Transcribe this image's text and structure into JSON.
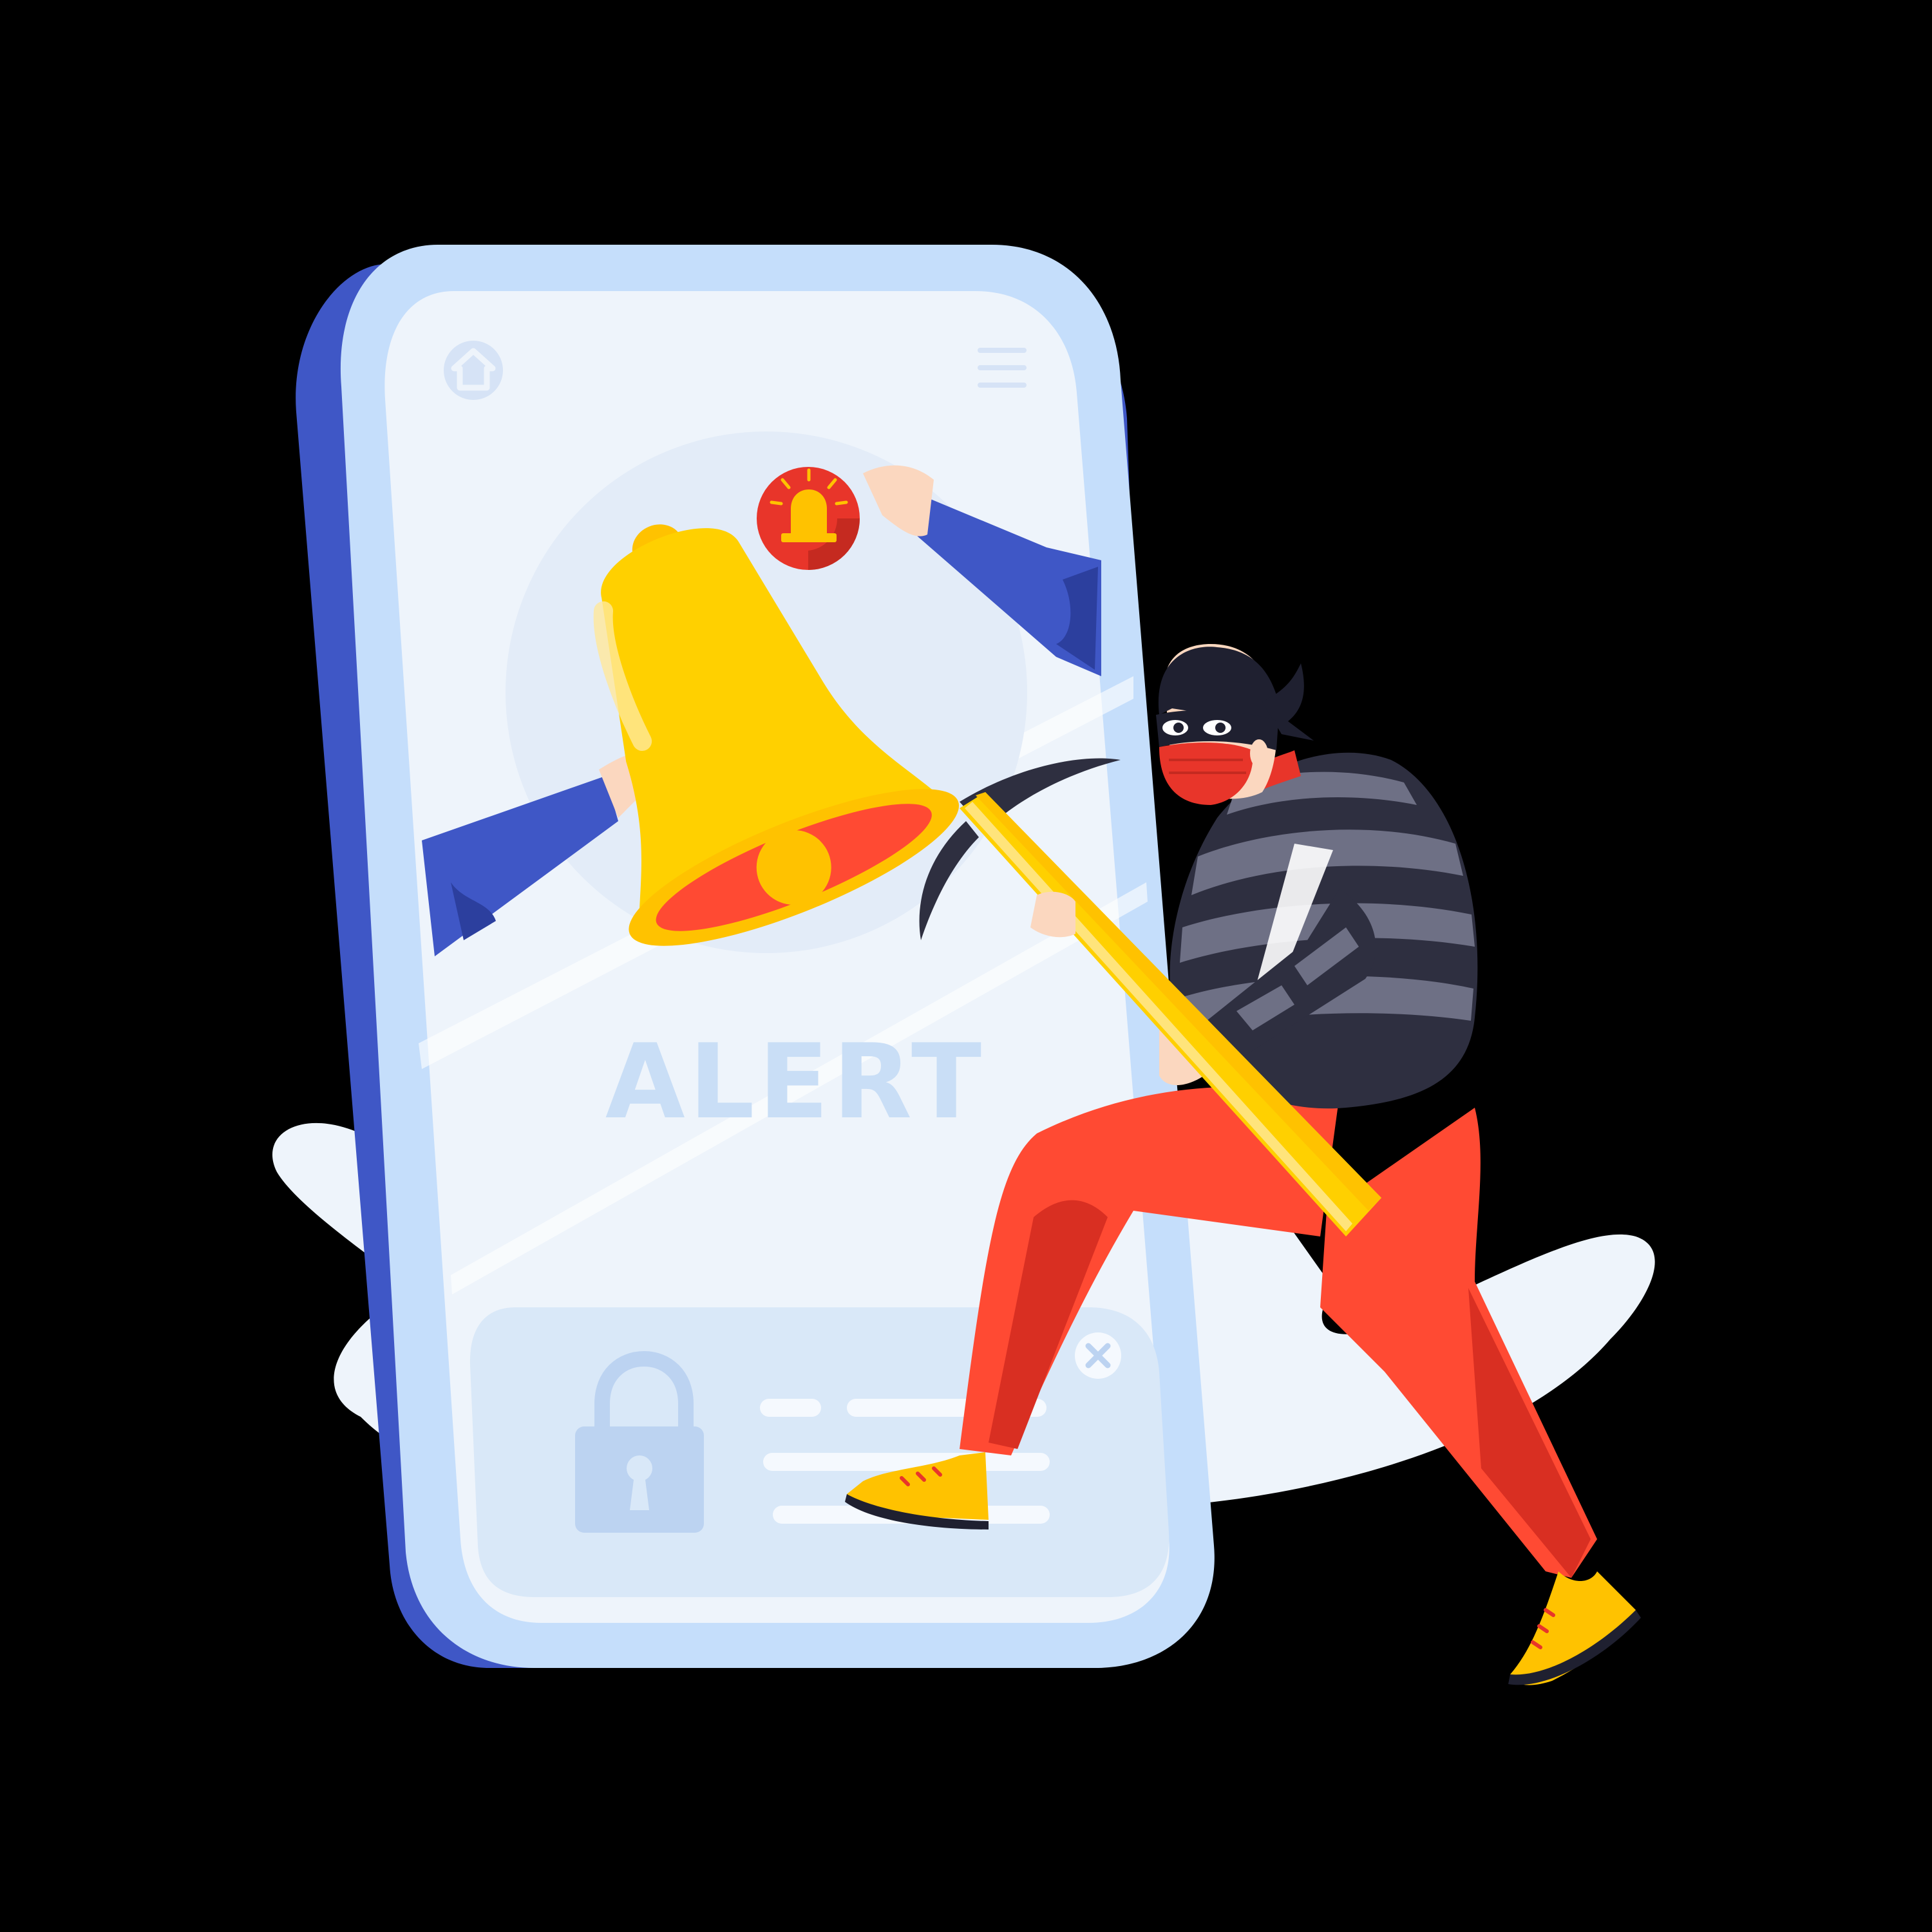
{
  "scene": {
    "background": "#000000",
    "phone": {
      "frame_color": "#C5DEFB",
      "shadow_color": "#3F57C6",
      "screen_color": "#EEF4FB",
      "top_bar": {
        "left_icon": "home-icon",
        "right_icon": "menu-icon"
      },
      "headline": "ALERT",
      "headline_color": "#C9DEF6",
      "notification_card": {
        "lock_icon": "padlock-icon",
        "close_icon": "close-icon",
        "placeholder_lines": 3
      }
    },
    "bell": {
      "icon": "bell-icon",
      "body_color": "#FFD000",
      "mouth_color": "#FF4A33"
    },
    "siren_badge": {
      "icon": "siren-icon",
      "color": "#E8352A"
    },
    "hands": {
      "sleeve_color": "#3F57C6",
      "count": 2
    },
    "thief": {
      "mask_color": "#1F2030",
      "face_mask_color": "#E8352A",
      "shirt_stripes": [
        "#2E2F40",
        "#6E7085"
      ],
      "pants_color": "#FF4A33",
      "shoe_color": "#FFC200",
      "tool": "pickaxe-icon",
      "tool_handle_color": "#FFD000"
    },
    "cloud_color": "#EEF4FB"
  }
}
